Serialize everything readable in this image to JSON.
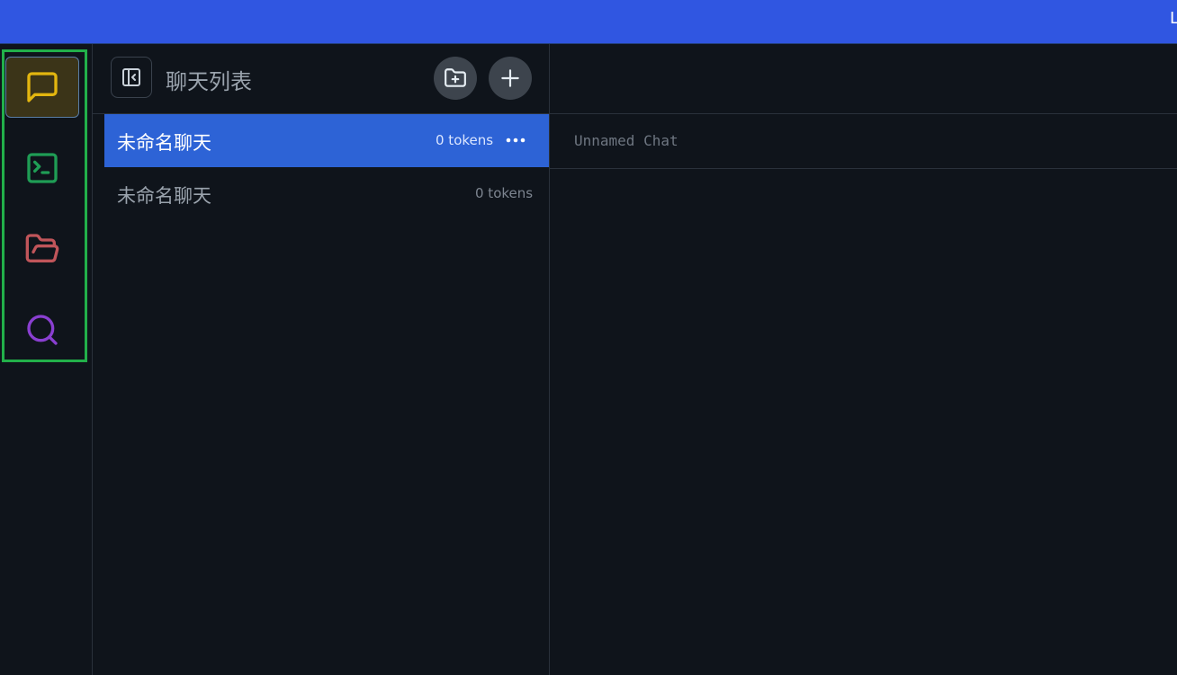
{
  "topbar": {
    "edge_text": "L"
  },
  "activity_bar": {
    "items": [
      {
        "icon": "message-square-icon",
        "color": "#e3b60f",
        "active": true
      },
      {
        "icon": "terminal-icon",
        "color": "#1f9d55",
        "active": false
      },
      {
        "icon": "folder-open-icon",
        "color": "#c0555a",
        "active": false
      },
      {
        "icon": "search-icon",
        "color": "#8a3fd1",
        "active": false
      }
    ]
  },
  "sidebar": {
    "title": "聊天列表",
    "chats": [
      {
        "name": "未命名聊天",
        "tokens": "0 tokens",
        "active": true
      },
      {
        "name": "未命名聊天",
        "tokens": "0 tokens",
        "active": false
      }
    ]
  },
  "main": {
    "chat_title": "Unnamed Chat"
  },
  "colors": {
    "topbar": "#3056e1",
    "background": "#0f141b",
    "active_chat": "#2d63d6",
    "highlight_border": "#22b04a"
  }
}
